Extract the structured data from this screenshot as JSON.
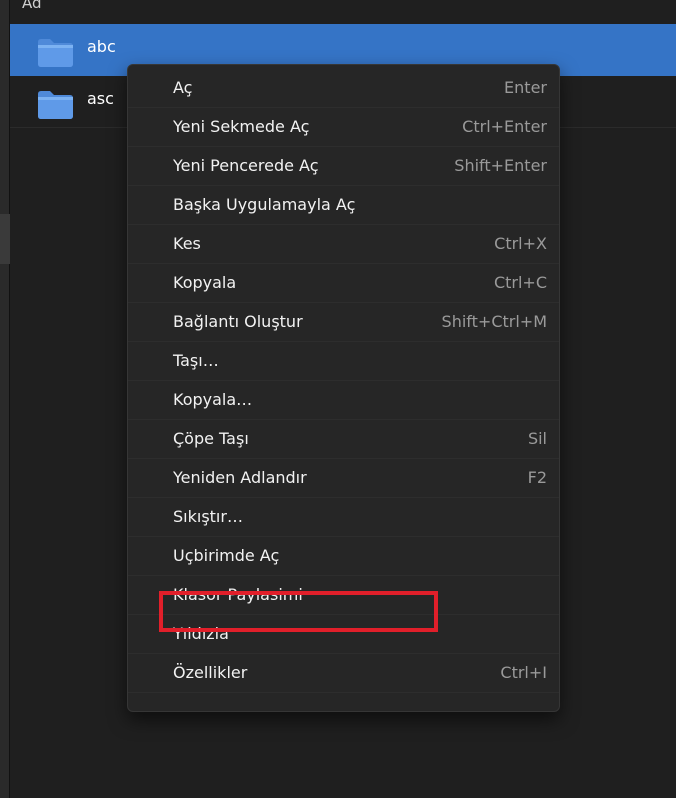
{
  "file_view": {
    "column_header": "Ad",
    "items": [
      {
        "name": "abc",
        "icon": "folder-icon",
        "selected": true
      },
      {
        "name": "asc",
        "icon": "folder-icon",
        "selected": false
      }
    ]
  },
  "context_menu": {
    "items": [
      {
        "label": "Aç",
        "shortcut": "Enter"
      },
      {
        "label": "Yeni Sekmede Aç",
        "shortcut": "Ctrl+Enter"
      },
      {
        "label": "Yeni Pencerede Aç",
        "shortcut": "Shift+Enter"
      },
      {
        "label": "Başka Uygulamayla Aç",
        "shortcut": ""
      },
      {
        "label": "Kes",
        "shortcut": "Ctrl+X"
      },
      {
        "label": "Kopyala",
        "shortcut": "Ctrl+C"
      },
      {
        "label": "Bağlantı Oluştur",
        "shortcut": "Shift+Ctrl+M"
      },
      {
        "label": "Taşı…",
        "shortcut": ""
      },
      {
        "label": "Kopyala…",
        "shortcut": ""
      },
      {
        "label": "Çöpe Taşı",
        "shortcut": "Sil"
      },
      {
        "label": "Yeniden Adlandır",
        "shortcut": "F2"
      },
      {
        "label": "Sıkıştır…",
        "shortcut": ""
      },
      {
        "label": "Uçbirimde Aç",
        "shortcut": ""
      },
      {
        "label": "Klasor Paylasimi",
        "shortcut": "",
        "highlighted": true
      },
      {
        "label": "Yıldızla",
        "shortcut": ""
      },
      {
        "label": "Özellikler",
        "shortcut": "Ctrl+I"
      }
    ]
  },
  "colors": {
    "selection": "#3574c6",
    "highlight_box": "#e11f2a",
    "menu_background": "#262626",
    "window_background": "#1f1f1f"
  }
}
